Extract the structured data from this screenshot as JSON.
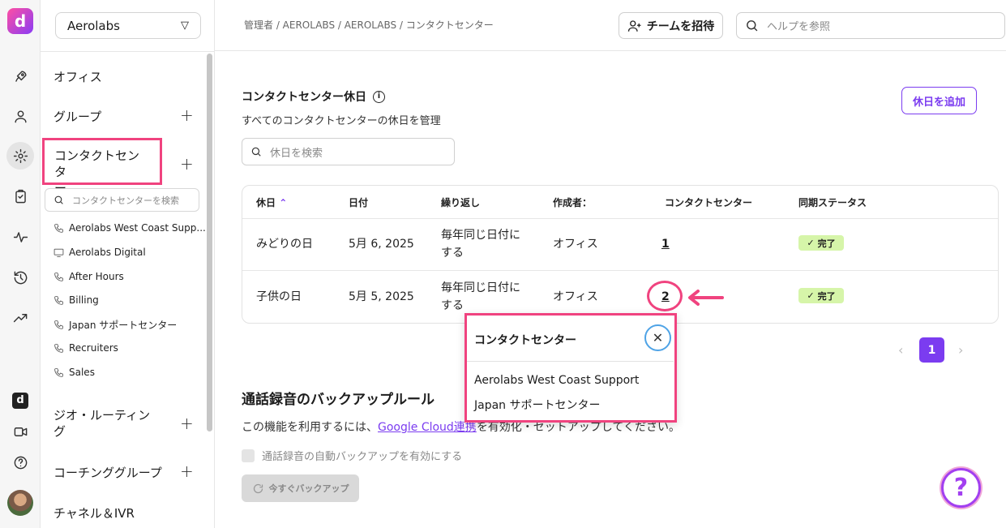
{
  "rail": {
    "logo_letter": "d",
    "items": [
      "rocket-icon",
      "user-icon",
      "gear-icon",
      "clipboard-icon",
      "activity-icon",
      "history-icon",
      "trending-icon"
    ],
    "bottom": [
      "dialpad-icon",
      "video-icon",
      "help-circle-icon",
      "avatar"
    ]
  },
  "sidebar": {
    "org": "Aerolabs",
    "nav": [
      {
        "label": "オフィス"
      },
      {
        "label": "グループ"
      },
      {
        "label": "コンタクトセンター"
      },
      {
        "label": "ジオ・ルーティング"
      },
      {
        "label": "コーチンググループ"
      },
      {
        "label": "チャネル＆IVR"
      }
    ],
    "cc_label_line1": "コンタクトセンタ",
    "cc_label_line2": "ー",
    "geo_line1": "ジオ・ルーティン",
    "geo_line2": "グ",
    "search_placeholder": "コンタクトセンターを検索",
    "contact_centers": [
      {
        "label": "Aerolabs West Coast Supp...",
        "icon": "phone-icon"
      },
      {
        "label": "Aerolabs Digital",
        "icon": "monitor-icon"
      },
      {
        "label": "After Hours",
        "icon": "phone-icon"
      },
      {
        "label": "Billing",
        "icon": "phone-icon"
      },
      {
        "label": "Japan サポートセンター",
        "icon": "phone-icon"
      },
      {
        "label": "Recruiters",
        "icon": "phone-icon"
      },
      {
        "label": "Sales",
        "icon": "phone-icon"
      }
    ]
  },
  "topbar": {
    "breadcrumb": "管理者 / AEROLABS / AEROLABS / コンタクトセンター",
    "invite_label": "チームを招待",
    "help_placeholder": "ヘルプを参照"
  },
  "holidays": {
    "title": "コンタクトセンター休日",
    "subtitle": "すべてのコンタクトセンターの休日を管理",
    "add_button": "休日を追加",
    "search_placeholder": "休日を検索",
    "columns": [
      "休日",
      "日付",
      "繰り返し",
      "作成者：",
      "コンタクトセンター",
      "同期ステータス"
    ],
    "rows": [
      {
        "name": "みどりの日",
        "date": "5月 6, 2025",
        "repeat_l1": "毎年同じ日付に",
        "repeat_l2": "する",
        "creator": "オフィス",
        "count": "1",
        "status": "完了"
      },
      {
        "name": "子供の日",
        "date": "5月 5, 2025",
        "repeat_l1": "毎年同じ日付に",
        "repeat_l2": "する",
        "creator": "オフィス",
        "count": "2",
        "status": "完了"
      }
    ],
    "page": "1"
  },
  "popup": {
    "title": "コンタクトセンター",
    "items": [
      "Aerolabs West Coast Support",
      "Japan サポートセンター"
    ]
  },
  "backup": {
    "title": "通話録音のバックアップルール",
    "desc_before": "この機能を利用するには、",
    "desc_link": "Google Cloud連携",
    "desc_after": "を有効化・セットアップしてください。",
    "checkbox_label": "通話録音の自動バックアップを有効にする",
    "button": "今すぐバックアップ"
  },
  "colors": {
    "accent": "#7b3cf0",
    "highlight": "#f0437f",
    "success_bg": "#d6f5a9"
  }
}
